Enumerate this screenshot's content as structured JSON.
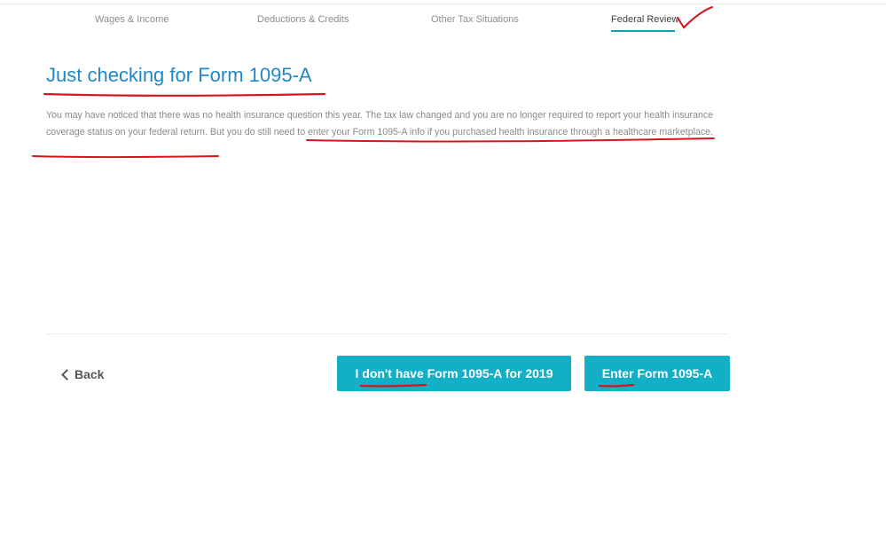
{
  "nav": {
    "tabs": [
      {
        "label": "Wages & Income",
        "active": false
      },
      {
        "label": "Deductions & Credits",
        "active": false
      },
      {
        "label": "Other Tax Situations",
        "active": false
      },
      {
        "label": "Federal Review",
        "active": true
      }
    ]
  },
  "main": {
    "title": "Just checking for Form 1095-A",
    "description_part1": "You may have noticed that there was no health insurance question this year. The tax law changed and you are no longer required to report your health insurance coverage status on your federal return. ",
    "description_part2": "But you do still need to enter your Form 1095-A info if you purchased health insurance through a healthcare marketplace."
  },
  "actions": {
    "back_label": "Back",
    "no_form_label": "I don't have Form 1095-A for 2019",
    "enter_form_label": "Enter Form 1095-A"
  },
  "footer": {
    "text": "…"
  },
  "colors": {
    "accent": "#12b0c6",
    "title": "#1e88c8",
    "annotation": "#d8141c"
  }
}
